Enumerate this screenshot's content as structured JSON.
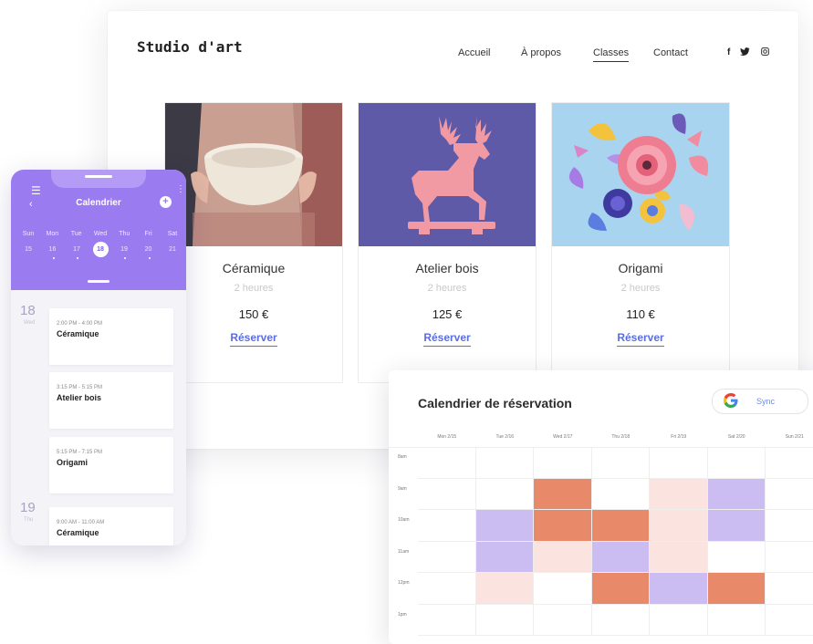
{
  "site": {
    "logo": "Studio d'art",
    "nav": [
      "Accueil",
      "À propos",
      "Classes",
      "Contact"
    ],
    "active_nav": "Classes",
    "social_icons": [
      "facebook-icon",
      "twitter-icon",
      "instagram-icon"
    ],
    "social": {
      "facebook": "f",
      "twitter": "🐦",
      "instagram": "◎"
    },
    "cards": [
      {
        "name": "Céramique",
        "duration": "2 heures",
        "price": "150 €",
        "cta": "Réserver",
        "image": "ceramic-bowl-photo"
      },
      {
        "name": "Atelier bois",
        "duration": "2 heures",
        "price": "125 €",
        "cta": "Réserver",
        "image": "wooden-deer-photo"
      },
      {
        "name": "Origami",
        "duration": "2 heures",
        "price": "110 €",
        "cta": "Réserver",
        "image": "paper-flowers-photo"
      }
    ]
  },
  "phone": {
    "title": "Calendrier",
    "weekdays": [
      "Sun",
      "Mon",
      "Tue",
      "Wed",
      "Thu",
      "Fri",
      "Sat"
    ],
    "dates": [
      "15",
      "16",
      "17",
      "18",
      "19",
      "20",
      "21"
    ],
    "selected_date": "18",
    "days": [
      {
        "num": "18",
        "label": "Wed"
      },
      {
        "num": "19",
        "label": "Thu"
      }
    ],
    "events": [
      {
        "time": "2:00 PM - 4:00 PM",
        "name": "Céramique"
      },
      {
        "time": "3:15 PM - 5:15 PM",
        "name": "Atelier bois"
      },
      {
        "time": "5:15 PM - 7:15 PM",
        "name": "Origami"
      },
      {
        "time": "9:00 AM - 11:00 AM",
        "name": "Céramique"
      }
    ]
  },
  "calendar": {
    "title": "Calendrier de réservation",
    "sync_label": "Sync",
    "sync_icon": "G",
    "columns": [
      "Mon 2/15",
      "Tue 2/16",
      "Wed 2/17",
      "Thu 2/18",
      "Fri 2/19",
      "Sat 2/20",
      "Sun 2/21"
    ],
    "rows": [
      "8am",
      "9am",
      "10am",
      "11am",
      "12pm",
      "1pm"
    ],
    "colors": {
      "orange": "#e8896a",
      "lavender": "#cbbdf2",
      "pink": "#fbe3e0",
      "purple_accent": "#9b7bf0"
    }
  }
}
